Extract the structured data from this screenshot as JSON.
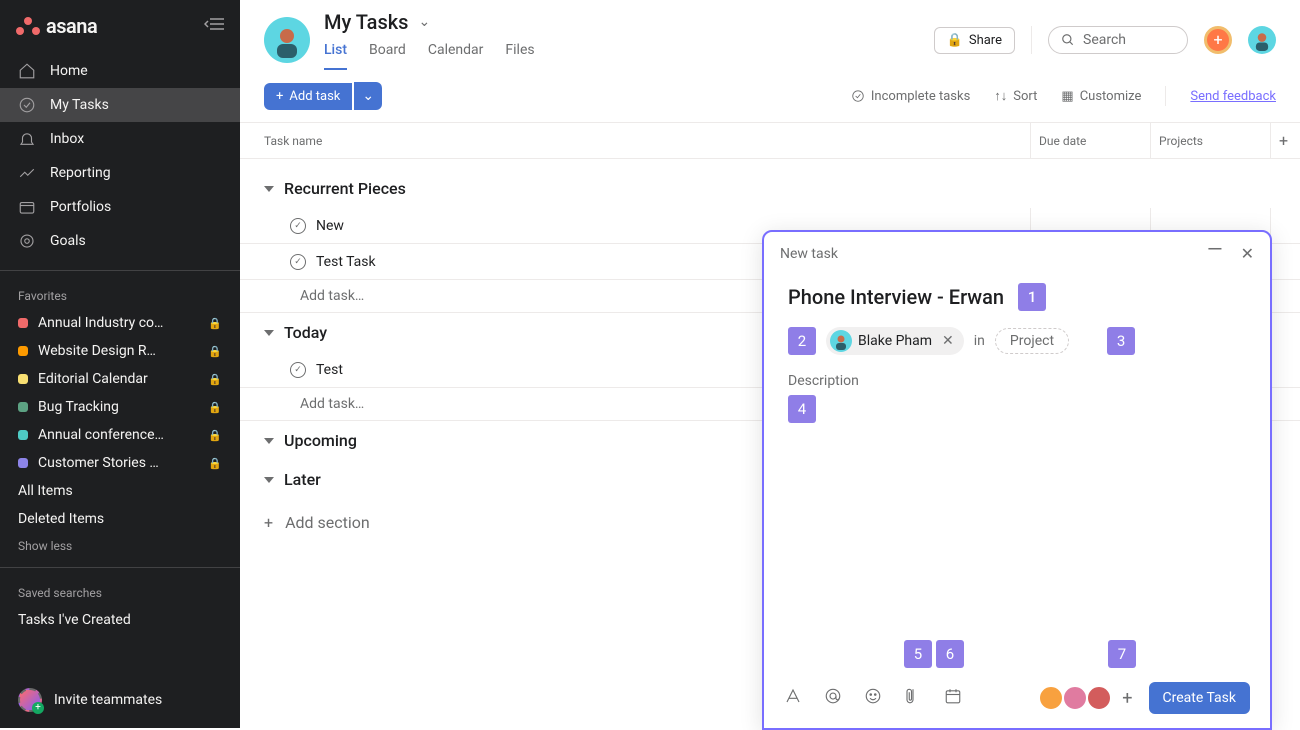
{
  "app": {
    "name": "asana"
  },
  "sidebar": {
    "nav": [
      {
        "label": "Home",
        "icon": "home-icon"
      },
      {
        "label": "My Tasks",
        "icon": "check-circle-icon",
        "active": true
      },
      {
        "label": "Inbox",
        "icon": "bell-icon"
      },
      {
        "label": "Reporting",
        "icon": "chart-icon"
      },
      {
        "label": "Portfolios",
        "icon": "folder-icon"
      },
      {
        "label": "Goals",
        "icon": "target-icon"
      }
    ],
    "favorites_label": "Favorites",
    "favorites": [
      {
        "label": "Annual Industry co…",
        "color": "#f06a6a",
        "locked": true
      },
      {
        "label": "Website Design R…",
        "color": "#fd9a00",
        "locked": true
      },
      {
        "label": "Editorial Calendar",
        "color": "#f8df72",
        "locked": true
      },
      {
        "label": "Bug Tracking",
        "color": "#5da283",
        "locked": true
      },
      {
        "label": "Annual conference…",
        "color": "#4ecbc4",
        "locked": true
      },
      {
        "label": "Customer Stories …",
        "color": "#8d84e8",
        "locked": true
      }
    ],
    "all_items": "All Items",
    "deleted_items": "Deleted Items",
    "show_less": "Show less",
    "saved_searches_label": "Saved searches",
    "saved_searches": [
      "Tasks I've Created"
    ],
    "invite": "Invite teammates"
  },
  "header": {
    "title": "My Tasks",
    "tabs": [
      {
        "label": "List",
        "active": true
      },
      {
        "label": "Board"
      },
      {
        "label": "Calendar"
      },
      {
        "label": "Files"
      }
    ],
    "share": "Share",
    "search_placeholder": "Search"
  },
  "toolbar": {
    "add_task": "Add task",
    "incomplete": "Incomplete tasks",
    "sort": "Sort",
    "customize": "Customize",
    "feedback": "Send feedback"
  },
  "columns": {
    "c1": "Task name",
    "c2": "Due date",
    "c3": "Projects"
  },
  "sections": [
    {
      "name": "Recurrent Pieces",
      "tasks": [
        {
          "name": "New"
        },
        {
          "name": "Test Task"
        }
      ],
      "add": "Add task…"
    },
    {
      "name": "Today",
      "tasks": [
        {
          "name": "Test"
        }
      ],
      "add": "Add task…"
    },
    {
      "name": "Upcoming",
      "tasks": []
    },
    {
      "name": "Later",
      "tasks": []
    }
  ],
  "add_section": "Add section",
  "popover": {
    "heading": "New task",
    "title": "Phone Interview - Erwan",
    "assignee": "Blake Pham",
    "in": "in",
    "project": "Project",
    "description_label": "Description",
    "create": "Create Task",
    "badges": {
      "b1": "1",
      "b2": "2",
      "b3": "3",
      "b4": "4",
      "b5": "5",
      "b6": "6",
      "b7": "7"
    },
    "collaborator_colors": [
      "#f8a13f",
      "#e07ba0",
      "#d35c5c"
    ]
  }
}
